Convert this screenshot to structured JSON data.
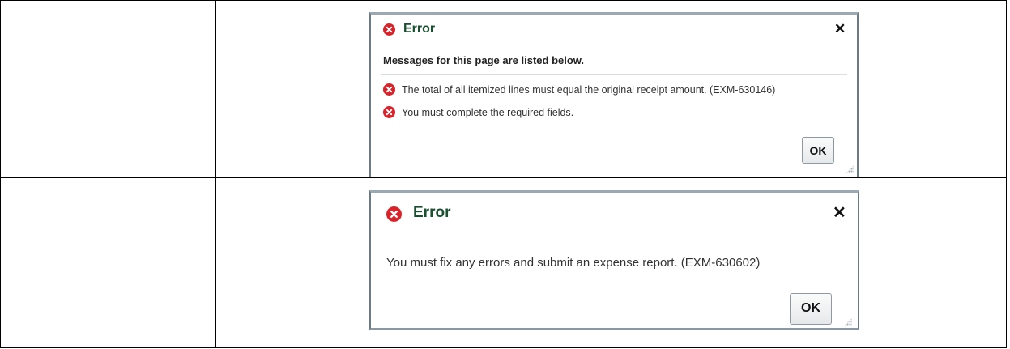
{
  "dialogs": [
    {
      "title": "Error",
      "close_glyph": "✕",
      "header_message": "Messages for this page are listed below.",
      "messages": [
        {
          "icon": "error-icon",
          "text": "The total of all itemized lines must equal the original receipt amount. (EXM-630146)"
        },
        {
          "icon": "error-icon",
          "text": "You must complete the required fields."
        }
      ],
      "ok_label": "OK"
    },
    {
      "title": "Error",
      "close_glyph": "✕",
      "message": "You must fix any errors and submit an expense report. (EXM-630602)",
      "ok_label": "OK"
    }
  ],
  "colors": {
    "error_red": "#d8232a",
    "title_green": "#1a4f30",
    "dialog_border": "#6c7a84"
  }
}
